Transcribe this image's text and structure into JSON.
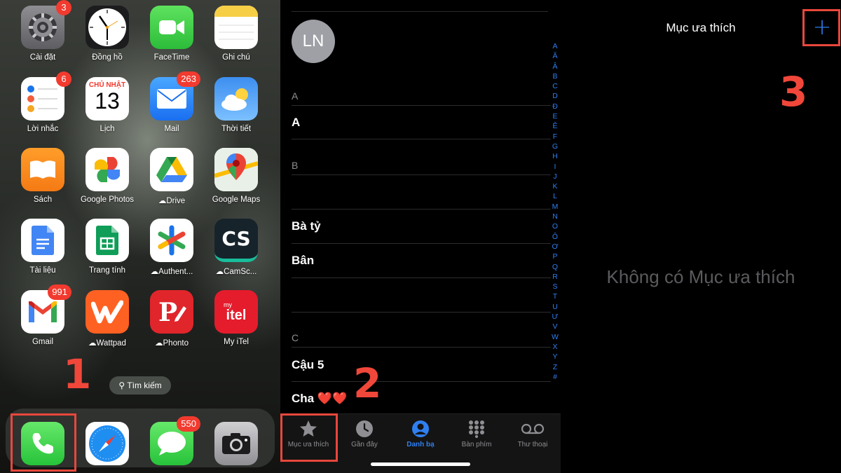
{
  "home": {
    "apps": [
      {
        "label": "Cài đặt",
        "badge": "3",
        "icon": "settings-gear-icon"
      },
      {
        "label": "Đồng hồ",
        "badge": "",
        "icon": "clock-icon"
      },
      {
        "label": "FaceTime",
        "badge": "",
        "icon": "facetime-camera-icon"
      },
      {
        "label": "Ghi chú",
        "badge": "",
        "icon": "notes-icon"
      },
      {
        "label": "Lời nhắc",
        "badge": "6",
        "icon": "reminders-icon"
      },
      {
        "label": "Lịch",
        "badge": "",
        "icon": "calendar-icon",
        "calendar_day": "CHỦ NHẬT",
        "calendar_date": "13"
      },
      {
        "label": "Mail",
        "badge": "263",
        "icon": "mail-envelope-icon"
      },
      {
        "label": "Thời tiết",
        "badge": "",
        "icon": "weather-icon"
      },
      {
        "label": "Sách",
        "badge": "",
        "icon": "books-icon"
      },
      {
        "label": "Google Photos",
        "badge": "",
        "icon": "google-photos-icon"
      },
      {
        "label": "Drive",
        "badge": "",
        "icon": "google-drive-icon",
        "cloud": true
      },
      {
        "label": "Google Maps",
        "badge": "",
        "icon": "google-maps-icon"
      },
      {
        "label": "Tài liệu",
        "badge": "",
        "icon": "google-docs-icon"
      },
      {
        "label": "Trang tính",
        "badge": "",
        "icon": "google-sheets-icon"
      },
      {
        "label": "Authent...",
        "badge": "",
        "icon": "authenticator-icon",
        "cloud": true
      },
      {
        "label": "CamSc...",
        "badge": "",
        "icon": "camscanner-icon",
        "cloud": true,
        "icon_text": "CS"
      },
      {
        "label": "Gmail",
        "badge": "991",
        "icon": "gmail-icon"
      },
      {
        "label": "Wattpad",
        "badge": "",
        "icon": "wattpad-icon",
        "cloud": true
      },
      {
        "label": "Phonto",
        "badge": "",
        "icon": "phonto-icon",
        "cloud": true
      },
      {
        "label": "My iTel",
        "badge": "",
        "icon": "my-itel-icon",
        "icon_text": "itel",
        "icon_small": "my"
      }
    ],
    "search_label": "Tìm kiếm",
    "dock": [
      {
        "icon": "phone-icon",
        "badge": ""
      },
      {
        "icon": "safari-compass-icon",
        "badge": ""
      },
      {
        "icon": "messages-icon",
        "badge": "550"
      },
      {
        "icon": "camera-icon",
        "badge": ""
      }
    ],
    "step_label": "1"
  },
  "contacts": {
    "avatar_initials": "LN",
    "sections": [
      {
        "header": "A",
        "rows": [
          "A"
        ]
      },
      {
        "header": "B",
        "rows": [
          "",
          "Bà tỷ",
          "Bân",
          ""
        ]
      },
      {
        "header": "C",
        "rows": [
          "Cậu 5",
          "Cha ❤️❤️"
        ]
      }
    ],
    "index_letters": [
      "A",
      "Ă",
      "Â",
      "B",
      "C",
      "D",
      "Đ",
      "E",
      "Ê",
      "F",
      "G",
      "H",
      "I",
      "J",
      "K",
      "L",
      "M",
      "N",
      "O",
      "Ô",
      "Ơ",
      "P",
      "Q",
      "R",
      "S",
      "T",
      "U",
      "Ư",
      "V",
      "W",
      "X",
      "Y",
      "Z",
      "#"
    ],
    "tabs": [
      {
        "label": "Mục ưa thích",
        "icon": "star-icon",
        "active": false
      },
      {
        "label": "Gần đây",
        "icon": "recents-clock-icon",
        "active": false
      },
      {
        "label": "Danh bạ",
        "icon": "contacts-person-icon",
        "active": true
      },
      {
        "label": "Bàn phím",
        "icon": "keypad-icon",
        "active": false
      },
      {
        "label": "Thư thoại",
        "icon": "voicemail-icon",
        "active": false
      }
    ],
    "step_label": "2"
  },
  "favorites": {
    "title": "Mục ưa thích",
    "add_icon": "plus-icon",
    "empty_text": "Không có Mục ưa thích",
    "step_label": "3"
  },
  "colors": {
    "accent_blue": "#2f7ff0",
    "badge_red": "#f23a2f",
    "highlight_red": "#e8473c"
  }
}
